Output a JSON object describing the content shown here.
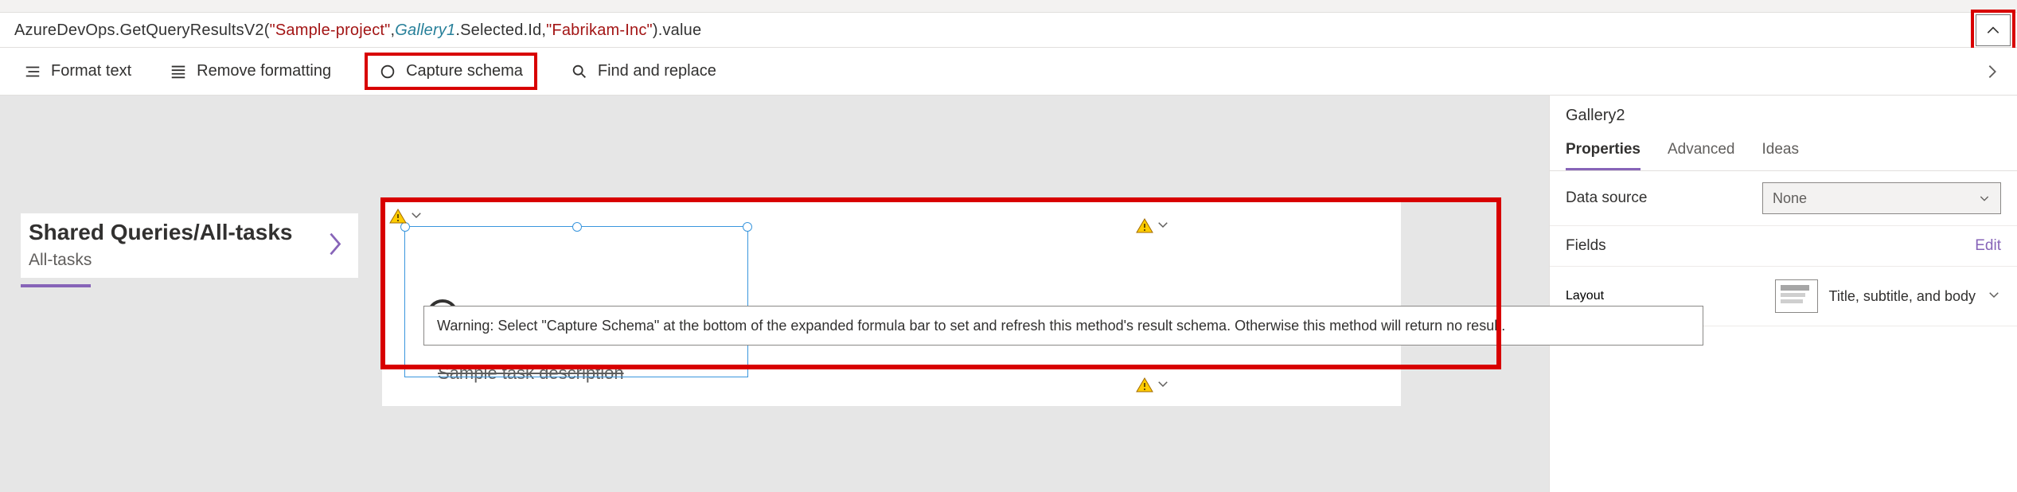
{
  "formula": {
    "method": "AzureDevOps.GetQueryResultsV2",
    "arg1": "\"Sample-project\"",
    "arg2_ident": "Gallery1",
    "arg2_suffix": ".Selected.Id",
    "arg3": "\"Fabrikam-Inc\"",
    "tail": ".value"
  },
  "toolbar": {
    "format_text": "Format text",
    "remove_formatting": "Remove formatting",
    "capture_schema": "Capture schema",
    "find_replace": "Find and replace"
  },
  "left_card": {
    "title": "Shared Queries/All-tasks",
    "subtitle": "All-tasks"
  },
  "struck_text": "Sample task description",
  "tooltip_text": "Warning: Select \"Capture Schema\" at the bottom of the expanded formula bar to set and refresh this method's result schema. Otherwise this method will return no result.",
  "right_panel": {
    "title": "Gallery2",
    "tabs": {
      "properties": "Properties",
      "advanced": "Advanced",
      "ideas": "Ideas"
    },
    "data_source_label": "Data source",
    "data_source_value": "None",
    "fields_label": "Fields",
    "fields_edit": "Edit",
    "layout_label": "Layout",
    "layout_value": "Title, subtitle, and body"
  }
}
